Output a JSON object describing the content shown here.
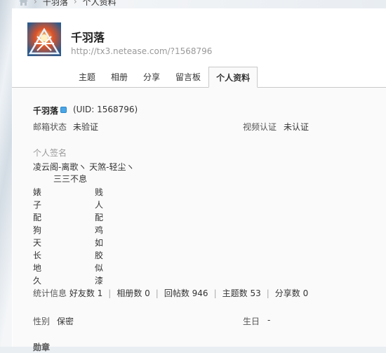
{
  "breadcrumb": {
    "items": [
      "千羽落",
      "个人资料"
    ]
  },
  "profile": {
    "nickname": "千羽落",
    "url": "http://tx3.netease.com/?1568796"
  },
  "tabs": [
    {
      "label": "主题",
      "active": false
    },
    {
      "label": "相册",
      "active": false
    },
    {
      "label": "分享",
      "active": false
    },
    {
      "label": "留言板",
      "active": false
    },
    {
      "label": "个人资料",
      "active": true
    }
  ],
  "info": {
    "username": "千羽落",
    "uid": "(UID: 1568796)",
    "email_label": "邮箱状态",
    "email_value": "未验证",
    "video_label": "视频认证",
    "video_value": "未认证",
    "signature_label": "个人签名",
    "signature_line1": "凌云阁-离歌ヽ 天煞-轻尘ヽ",
    "signature_line2": "三三不息",
    "poem_rows": [
      {
        "left": "婊",
        "right": "贱"
      },
      {
        "left": "子",
        "right": "人"
      },
      {
        "left": "配",
        "right": "配"
      },
      {
        "left": "狗",
        "right": "鸡"
      },
      {
        "left": "天",
        "right": "如"
      },
      {
        "left": "长",
        "right": "胶"
      },
      {
        "left": "地",
        "right": "似"
      },
      {
        "left": "久",
        "right": "漆"
      }
    ],
    "stats_label": "统计信息",
    "stats": [
      "好友数 1",
      "相册数 0",
      "回帖数 946",
      "主题数 53",
      "分享数 0"
    ],
    "gender_label": "性别",
    "gender_value": "保密",
    "birthday_label": "生日",
    "birthday_value": "-",
    "medal_label": "勋章"
  },
  "colors": {
    "panel_bg": "#ffffff",
    "content_bg": "#fafafa",
    "vip_badge": "#4aa6e6",
    "url_gray": "#999999"
  }
}
